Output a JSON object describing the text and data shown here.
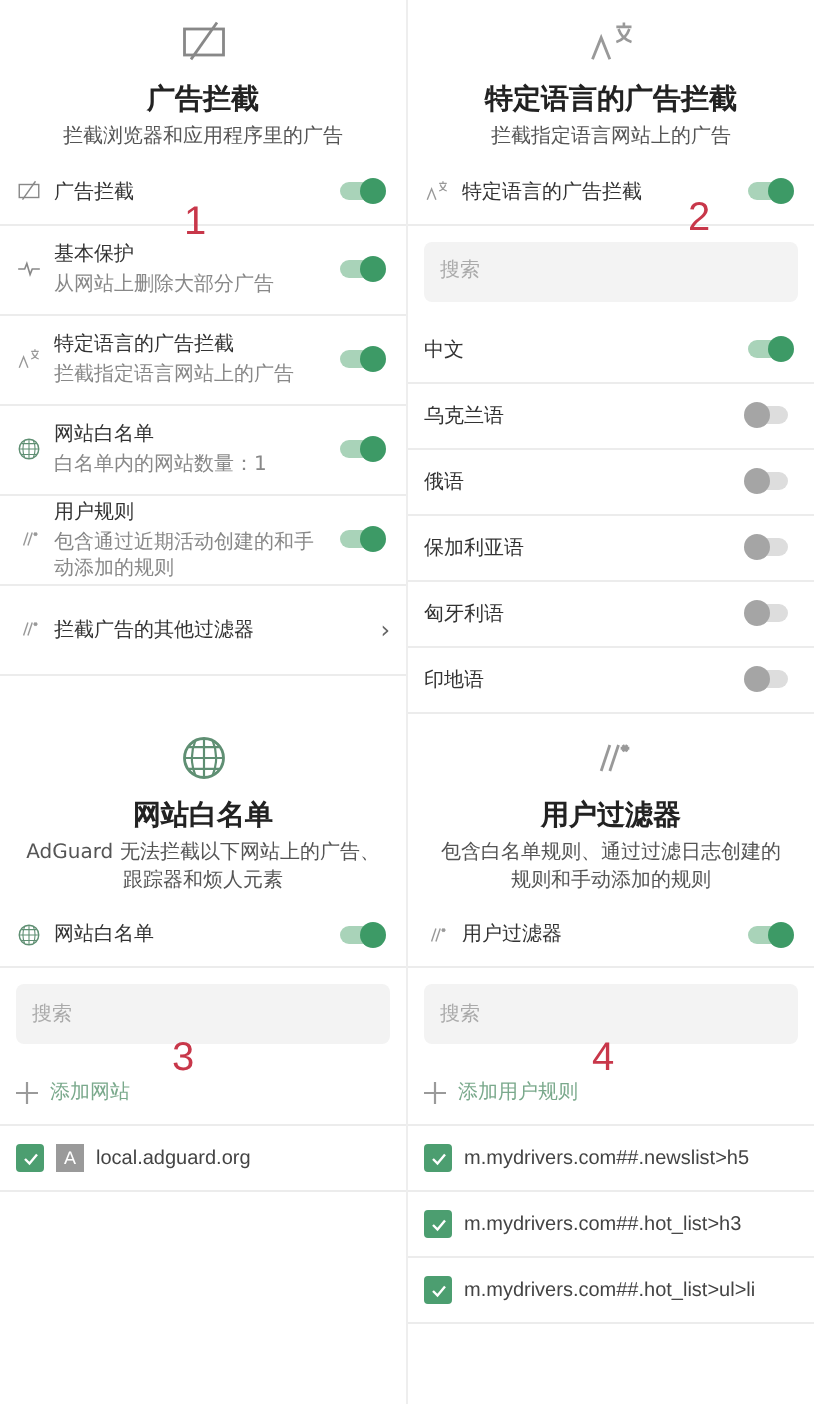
{
  "panels": [
    {
      "title": "广告拦截",
      "subtitle": "拦截浏览器和应用程序里的广告",
      "marker": "1",
      "rows": [
        {
          "kind": "toggle",
          "label": "广告拦截",
          "on": true
        },
        {
          "kind": "toggle",
          "label": "基本保护",
          "sub": "从网站上删除大部分广告",
          "on": true
        },
        {
          "kind": "toggle",
          "label": "特定语言的广告拦截",
          "sub": "拦截指定语言网站上的广告",
          "on": true
        },
        {
          "kind": "toggle",
          "label": "网站白名单",
          "sub": "白名单内的网站数量：1",
          "on": true
        },
        {
          "kind": "toggle",
          "label": "用户规则",
          "sub": "包含通过近期活动创建的和手动添加的规则",
          "on": true
        },
        {
          "kind": "link",
          "label": "拦截广告的其他过滤器",
          "chevron": "›"
        }
      ]
    },
    {
      "title": "特定语言的广告拦截",
      "subtitle": "拦截指定语言网站上的广告",
      "marker": "2",
      "rows": [
        {
          "kind": "toggle",
          "label": "特定语言的广告拦截",
          "on": true
        },
        {
          "kind": "search",
          "placeholder": "搜索"
        },
        {
          "kind": "toggle",
          "label": "中文",
          "on": true
        },
        {
          "kind": "toggle",
          "label": "乌克兰语",
          "on": false
        },
        {
          "kind": "toggle",
          "label": "俄语",
          "on": false
        },
        {
          "kind": "toggle",
          "label": "保加利亚语",
          "on": false
        },
        {
          "kind": "toggle",
          "label": "匈牙利语",
          "on": false
        },
        {
          "kind": "toggle",
          "label": "印地语",
          "on": false
        }
      ]
    },
    {
      "title": "网站白名单",
      "subtitle": "AdGuard 无法拦截以下网站上的广告、跟踪器和烦人元素",
      "marker": "3",
      "rows": [
        {
          "kind": "toggle",
          "label": "网站白名单",
          "on": true
        },
        {
          "kind": "search",
          "placeholder": "搜索"
        },
        {
          "kind": "add",
          "label": "添加网站"
        },
        {
          "kind": "check",
          "badge": "A",
          "label": "local.adguard.org",
          "checked": true
        }
      ]
    },
    {
      "title": "用户过滤器",
      "subtitle": "包含白名单规则、通过过滤日志创建的规则和手动添加的规则",
      "marker": "4",
      "rows": [
        {
          "kind": "toggle",
          "label": "用户过滤器",
          "on": true
        },
        {
          "kind": "search",
          "placeholder": "搜索"
        },
        {
          "kind": "add",
          "label": "添加用户规则"
        },
        {
          "kind": "check",
          "label": "m.mydrivers.com##.newslist>h5",
          "checked": true
        },
        {
          "kind": "check",
          "label": "m.mydrivers.com##.hot_list>h3",
          "checked": true
        },
        {
          "kind": "check",
          "label": "m.mydrivers.com##.hot_list>ul>li",
          "checked": true
        }
      ]
    }
  ]
}
